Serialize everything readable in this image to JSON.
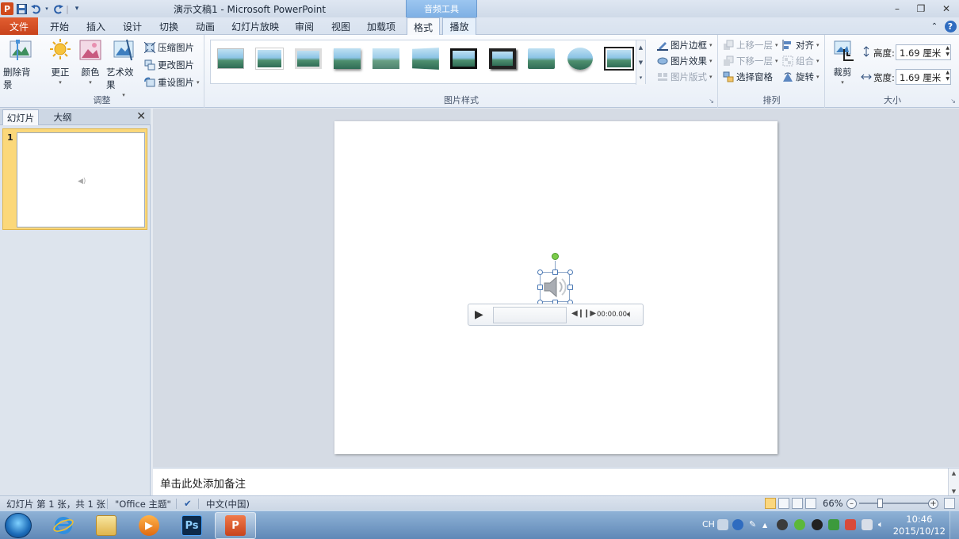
{
  "window": {
    "title": "演示文稿1 - Microsoft PowerPoint",
    "context_group": "音频工具",
    "app_icon": "P",
    "controls": {
      "minimize": "–",
      "restore": "❐",
      "close": "✕"
    }
  },
  "quick_access": {
    "save_icon": "save-icon",
    "undo_icon": "undo-icon",
    "redo_icon": "redo-icon",
    "customize_icon": "customize-icon"
  },
  "tabs": {
    "file": "文件",
    "items": [
      "开始",
      "插入",
      "设计",
      "切换",
      "动画",
      "幻灯片放映",
      "审阅",
      "视图",
      "加载项",
      "格式",
      "播放"
    ],
    "active": "格式",
    "help": "?",
    "collapse": "⌃"
  },
  "ribbon": {
    "adjust": {
      "label": "调整",
      "remove_bg": "删除背景",
      "corrections": "更正",
      "color": "颜色",
      "artistic": "艺术效果",
      "compress": "压缩图片",
      "change": "更改图片",
      "reset": "重设图片"
    },
    "styles": {
      "label": "图片样式",
      "border": "图片边框",
      "effects": "图片效果",
      "layout": "图片版式"
    },
    "arrange": {
      "label": "排列",
      "bring_forward": "上移一层",
      "send_backward": "下移一层",
      "selection_pane": "选择窗格",
      "align": "对齐",
      "group": "组合",
      "rotate": "旋转"
    },
    "size": {
      "label": "大小",
      "crop": "裁剪",
      "height_label": "高度:",
      "height_value": "1.69 厘米",
      "width_label": "宽度:",
      "width_value": "1.69 厘米"
    }
  },
  "left_panel": {
    "tab_slides": "幻灯片",
    "tab_outline": "大纲",
    "close": "✕",
    "slide_number": "1"
  },
  "player": {
    "time": "00:00.00"
  },
  "notes": {
    "placeholder": "单击此处添加备注"
  },
  "status": {
    "slide_info": "幻灯片 第 1 张，共 1 张",
    "theme": "\"Office 主题\"",
    "language": "中文(中国)",
    "zoom": "66%"
  },
  "taskbar": {
    "lang": "CH",
    "time": "10:46",
    "date": "2015/10/12",
    "photoshop_label": "Ps",
    "powerpoint_label": "P"
  }
}
